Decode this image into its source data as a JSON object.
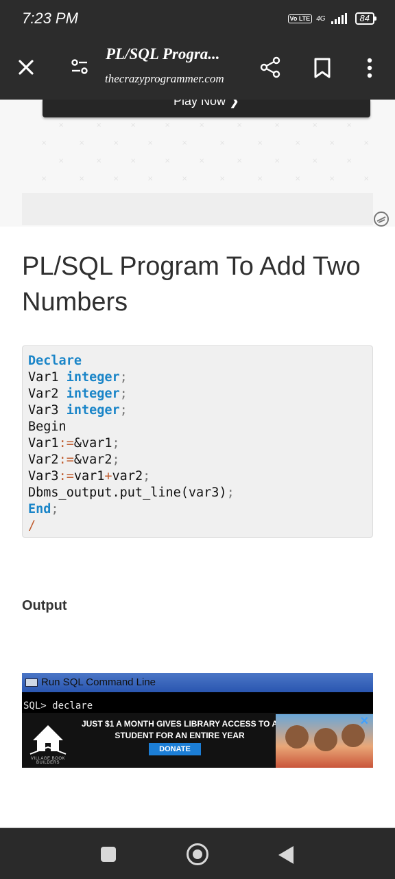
{
  "status": {
    "time": "7:23 PM",
    "volte": "Vo LTE",
    "network": "4G",
    "battery": "84"
  },
  "toolbar": {
    "title": "PL/SQL Progra...",
    "url": "thecrazyprogrammer.com",
    "icons": [
      "close-icon",
      "tune-icon",
      "share-icon",
      "bookmark-icon",
      "more-vert-icon"
    ]
  },
  "ad_top": {
    "button_label": "Play Now ❯"
  },
  "article": {
    "heading": "PL/SQL Program To Add Two Numbers",
    "code": [
      [
        {
          "t": "Declare",
          "c": "kw"
        }
      ],
      [
        {
          "t": "Var1 ",
          "c": ""
        },
        {
          "t": "integer",
          "c": "kw"
        },
        {
          "t": ";",
          "c": "muted"
        }
      ],
      [
        {
          "t": "Var2 ",
          "c": ""
        },
        {
          "t": "integer",
          "c": "kw"
        },
        {
          "t": ";",
          "c": "muted"
        }
      ],
      [
        {
          "t": "Var3 ",
          "c": ""
        },
        {
          "t": "integer",
          "c": "kw"
        },
        {
          "t": ";",
          "c": "muted"
        }
      ],
      [
        {
          "t": "Begin",
          "c": ""
        }
      ],
      [
        {
          "t": "Var1",
          "c": ""
        },
        {
          "t": ":=",
          "c": "op"
        },
        {
          "t": "&var1",
          "c": ""
        },
        {
          "t": ";",
          "c": "muted"
        }
      ],
      [
        {
          "t": "Var2",
          "c": ""
        },
        {
          "t": ":=",
          "c": "op"
        },
        {
          "t": "&var2",
          "c": ""
        },
        {
          "t": ";",
          "c": "muted"
        }
      ],
      [
        {
          "t": "Var3",
          "c": ""
        },
        {
          "t": ":=",
          "c": "op"
        },
        {
          "t": "var1",
          "c": ""
        },
        {
          "t": "+",
          "c": "op"
        },
        {
          "t": "var2",
          "c": ""
        },
        {
          "t": ";",
          "c": "muted"
        }
      ],
      [
        {
          "t": "Dbms_output.put_line(var3)",
          "c": ""
        },
        {
          "t": ";",
          "c": "muted"
        }
      ],
      [
        {
          "t": "End",
          "c": "kw"
        },
        {
          "t": ";",
          "c": "muted"
        }
      ],
      [
        {
          "t": "/",
          "c": "op"
        }
      ]
    ],
    "output_label": "Output"
  },
  "sql_window": {
    "title": "Run SQL Command Line",
    "prompt": "SQL> declare"
  },
  "donate_ad": {
    "text": "JUST $1 A MONTH GIVES LIBRARY ACCESS TO A STUDENT FOR AN ENTIRE YEAR",
    "button": "DONATE",
    "logo": "VILLAGE BOOK BUILDERS",
    "close": "✕"
  },
  "colors": {
    "bar_bg": "#2c2c2c",
    "code_keyword": "#1a85c8",
    "code_operator": "#c05e31",
    "code_bg": "#f0f0f0"
  },
  "navbar": {
    "icons": [
      "recents-square-icon",
      "home-circle-icon",
      "back-triangle-icon"
    ]
  }
}
